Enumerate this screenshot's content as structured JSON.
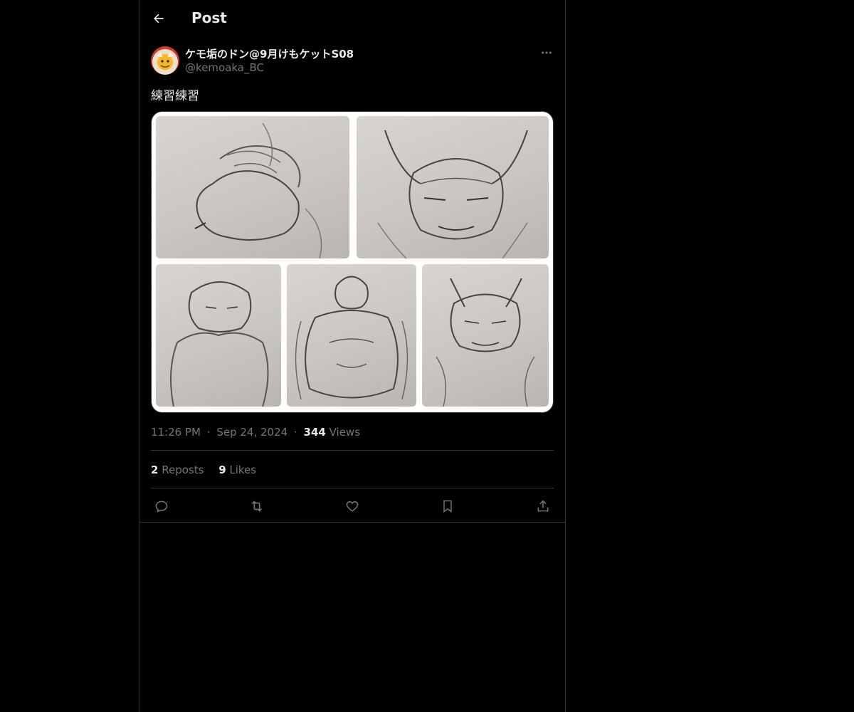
{
  "header": {
    "title": "Post",
    "back_icon": "arrow-left-icon"
  },
  "author": {
    "display_name": "ケモ垢のドン@9月けもケットS08",
    "handle": "@kemoaka_BC",
    "avatar_icon": "avatar"
  },
  "post": {
    "text": "練習練習",
    "media_description_icons": [
      "sketch-image"
    ],
    "time": "11:26 PM",
    "separator": "·",
    "date": "Sep 24, 2024",
    "views_count": "344",
    "views_label": "Views"
  },
  "stats": {
    "reposts_count": "2",
    "reposts_label": "Reposts",
    "likes_count": "9",
    "likes_label": "Likes"
  },
  "actions": {
    "reply_icon": "reply-icon",
    "repost_icon": "repost-icon",
    "like_icon": "heart-icon",
    "bookmark_icon": "bookmark-icon",
    "share_icon": "share-icon",
    "more_icon": "more-icon"
  },
  "colors": {
    "background": "#000000",
    "text_primary": "#e7e9ea",
    "text_secondary": "#71767b",
    "border": "#2f3336"
  }
}
